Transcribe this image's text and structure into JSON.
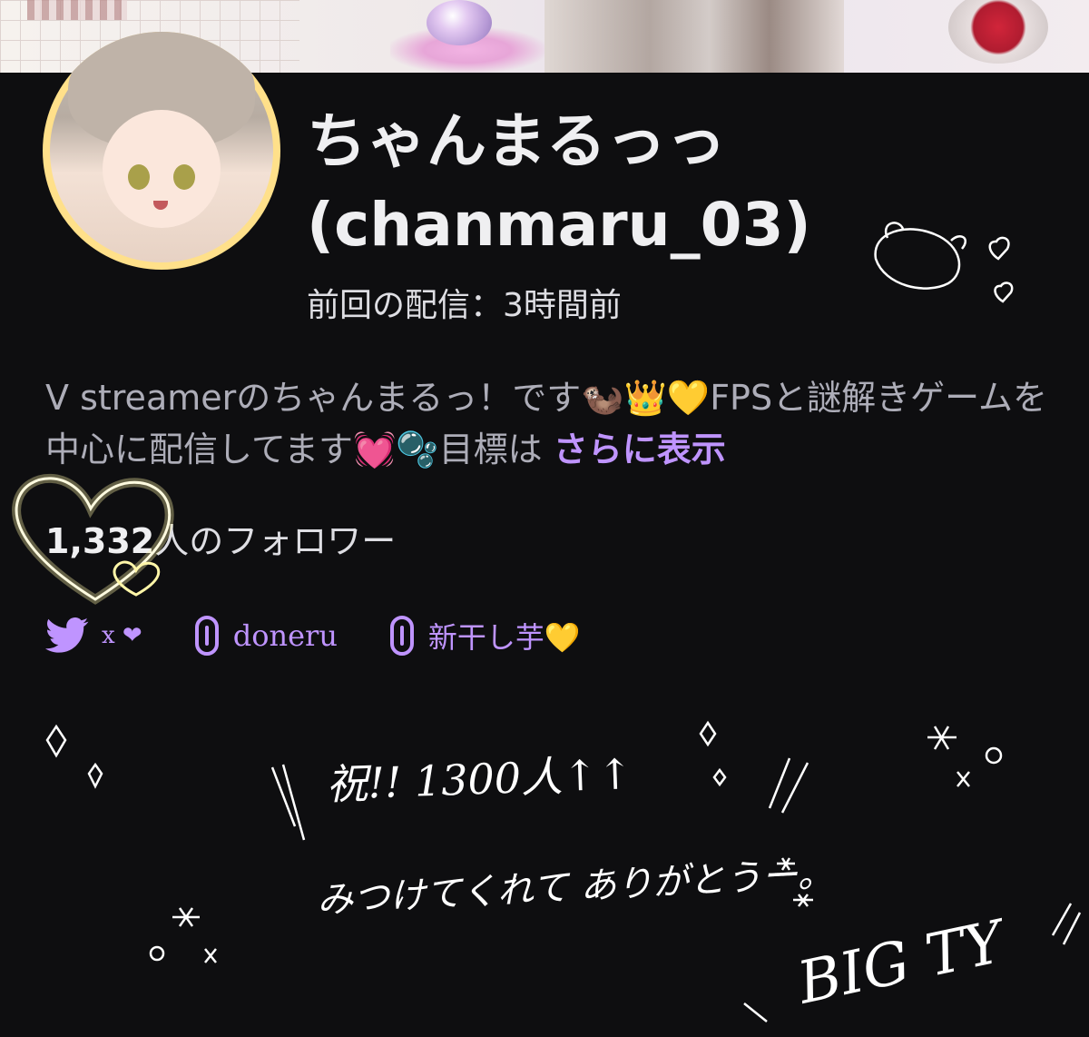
{
  "channel": {
    "display_name": "ちゃんまるっっ",
    "username": "(chanmaru_03)",
    "last_stream": "前回の配信：3時間前",
    "bio": "V streamerのちゃんまるっ！です🦦👑💛FPSと謎解きゲームを中心に配信してます💓🫧目標は",
    "bio_more": "さらに表示",
    "followers_count": "1,332",
    "followers_label": "人のフォロワー"
  },
  "links": [
    {
      "icon": "twitter-bird-icon",
      "label": "x ❤"
    },
    {
      "icon": "link-icon",
      "label": "doneru"
    },
    {
      "icon": "link-icon",
      "label": "新干し芋💛"
    }
  ],
  "doodles": {
    "celebration": "祝!! 1300人↑↑",
    "thanks": "みつけてくれて ありがとうー。",
    "big_ty": "BIG TY"
  },
  "colors": {
    "background": "#0e0e10",
    "accent": "#bf94ff",
    "text": "#efeff1",
    "muted": "#adadb8",
    "glow": "#fff6a8"
  }
}
